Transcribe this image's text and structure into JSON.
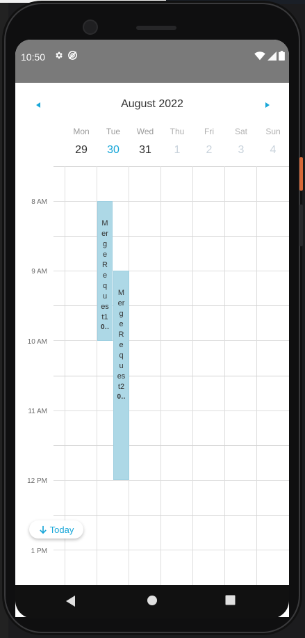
{
  "status_bar": {
    "time": "10:50",
    "left_icons": [
      "gear-icon",
      "target-icon"
    ],
    "right_icons": [
      "wifi-icon",
      "signal-icon",
      "battery-icon"
    ]
  },
  "calendar": {
    "month_title": "August 2022",
    "days": [
      {
        "name": "Mon",
        "num": "29",
        "state": "past"
      },
      {
        "name": "Tue",
        "num": "30",
        "state": "today"
      },
      {
        "name": "Wed",
        "num": "31",
        "state": "past"
      },
      {
        "name": "Thu",
        "num": "1",
        "state": "future"
      },
      {
        "name": "Fri",
        "num": "2",
        "state": "future"
      },
      {
        "name": "Sat",
        "num": "3",
        "state": "future"
      },
      {
        "name": "Sun",
        "num": "4",
        "state": "future"
      }
    ],
    "hours": [
      "8 AM",
      "9 AM",
      "10 AM",
      "11 AM",
      "12 PM",
      "1 PM"
    ],
    "events": [
      {
        "title": "MergeRequest1",
        "time": "0…",
        "day": "Tue",
        "start": "8 AM",
        "end": "10 AM"
      },
      {
        "title": "MergeRequest2",
        "time": "0…",
        "day": "Tue",
        "start": "9 AM",
        "end": "12 PM"
      }
    ],
    "today_button": "Today"
  },
  "colors": {
    "accent": "#17a6d8",
    "event_bg": "#add8e6",
    "status_bar": "#7a7a7a"
  }
}
